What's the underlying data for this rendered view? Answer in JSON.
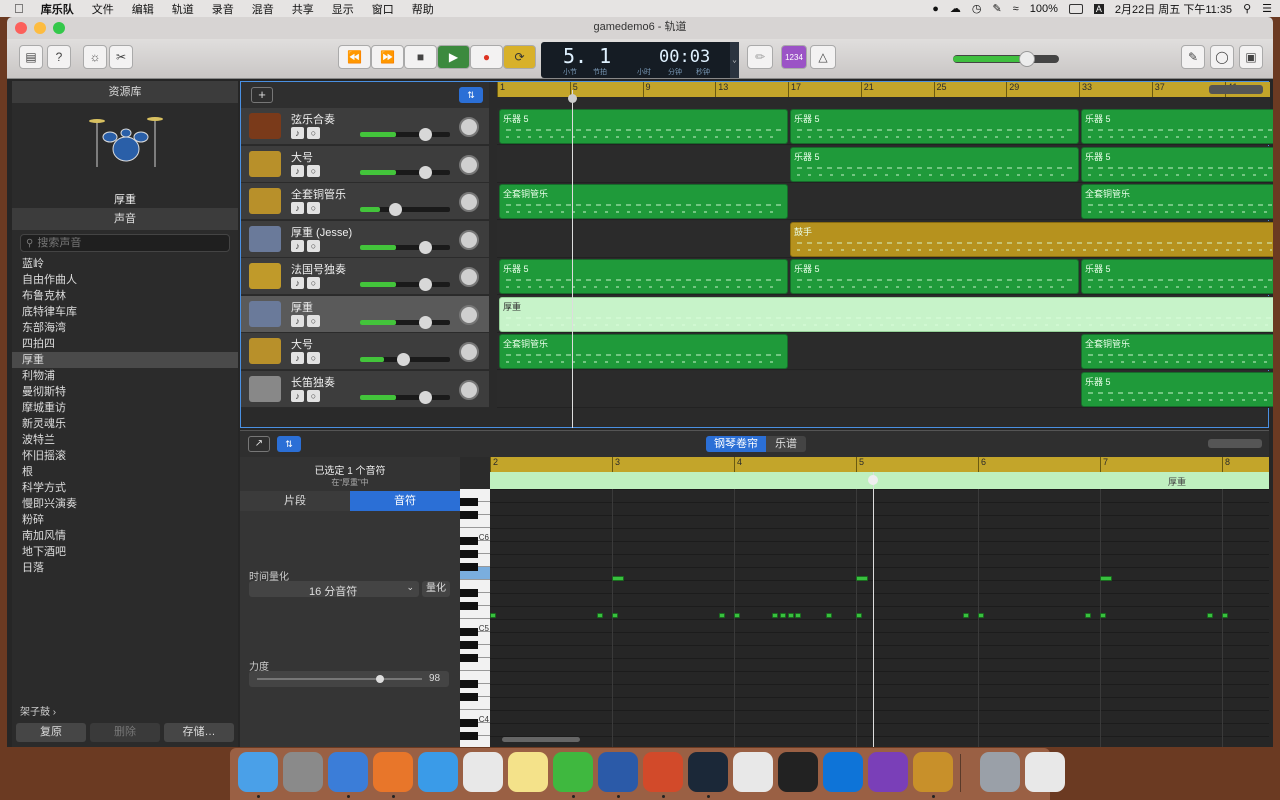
{
  "menubar": {
    "app": "库乐队",
    "items": [
      "文件",
      "编辑",
      "轨道",
      "录音",
      "混音",
      "共享",
      "显示",
      "窗口",
      "帮助"
    ],
    "battery": "100%",
    "clock": "2月22日 周五 下午11:35"
  },
  "window": {
    "title": "gamedemo6 - 轨道"
  },
  "lcd": {
    "bar_beat": "5. 1",
    "bar_label": "小节",
    "beat_label": "节拍",
    "time": "00:03",
    "hour_label": "小时",
    "min_label": "分钟",
    "sec_label": "秒钟"
  },
  "toolbar": {
    "count_in": "1234"
  },
  "library": {
    "header": "资源库",
    "patch_name": "厚重",
    "sounds_header": "声音",
    "search_placeholder": "搜索声音",
    "sounds": [
      "蓝岭",
      "自由作曲人",
      "布鲁克林",
      "底特律车库",
      "东部海湾",
      "四拍四",
      "厚重",
      "利物浦",
      "曼彻斯特",
      "摩城重访",
      "新灵魂乐",
      "波特兰",
      "怀旧摇滚",
      "根",
      "科学方式",
      "慢即兴演奏",
      "粉碎",
      "南加风情",
      "地下酒吧",
      "日落"
    ],
    "selected_index": 6,
    "kit_label": "架子鼓",
    "revert": "复原",
    "delete": "删除",
    "save": "存储…"
  },
  "ruler": {
    "bars": [
      "1",
      "5",
      "9",
      "13",
      "17",
      "21",
      "25",
      "29",
      "33",
      "37",
      "41"
    ]
  },
  "tracks": [
    {
      "name": "弦乐合奏",
      "color": "#7a3a1a",
      "vol": 0.73
    },
    {
      "name": "大号",
      "color": "#b8902a",
      "vol": 0.73
    },
    {
      "name": "全套铜管乐",
      "color": "#b8902a",
      "vol": 0.4
    },
    {
      "name": "厚重 (Jesse)",
      "color": "#6a7a9a",
      "vol": 0.73
    },
    {
      "name": "法国号独奏",
      "color": "#c09a2a",
      "vol": 0.73
    },
    {
      "name": "厚重",
      "color": "#6a7a9a",
      "vol": 0.73
    },
    {
      "name": "大号",
      "color": "#b8902a",
      "vol": 0.49
    },
    {
      "name": "长笛独奏",
      "color": "#888888",
      "vol": 0.73
    }
  ],
  "regions": [
    {
      "track": 0,
      "bar": 1,
      "len": 16,
      "label": "乐器 5",
      "kind": "green"
    },
    {
      "track": 0,
      "bar": 17,
      "len": 16,
      "label": "乐器 5",
      "kind": "green"
    },
    {
      "track": 0,
      "bar": 33,
      "len": 11,
      "label": "乐器 5",
      "kind": "green"
    },
    {
      "track": 1,
      "bar": 17,
      "len": 16,
      "label": "乐器 5",
      "kind": "green"
    },
    {
      "track": 1,
      "bar": 33,
      "len": 11,
      "label": "乐器 5",
      "kind": "green"
    },
    {
      "track": 2,
      "bar": 1,
      "len": 16,
      "label": "全套铜管乐",
      "kind": "green"
    },
    {
      "track": 2,
      "bar": 33,
      "len": 11,
      "label": "全套铜管乐",
      "kind": "green"
    },
    {
      "track": 3,
      "bar": 17,
      "len": 27,
      "label": "鼓手",
      "kind": "drum"
    },
    {
      "track": 4,
      "bar": 1,
      "len": 16,
      "label": "乐器 5",
      "kind": "green"
    },
    {
      "track": 4,
      "bar": 17,
      "len": 16,
      "label": "乐器 5",
      "kind": "green"
    },
    {
      "track": 4,
      "bar": 33,
      "len": 11,
      "label": "乐器 5",
      "kind": "green"
    },
    {
      "track": 5,
      "bar": 1,
      "len": 43,
      "label": "厚重",
      "kind": "selected"
    },
    {
      "track": 6,
      "bar": 1,
      "len": 16,
      "label": "全套铜管乐",
      "kind": "green"
    },
    {
      "track": 6,
      "bar": 33,
      "len": 11,
      "label": "全套铜管乐",
      "kind": "green"
    },
    {
      "track": 7,
      "bar": 33,
      "len": 11,
      "label": "乐器 5",
      "kind": "green"
    }
  ],
  "editor": {
    "tab_piano": "钢琴卷帘",
    "tab_score": "乐谱",
    "selected_info": "已选定 1 个音符",
    "selected_sub": "在“厚重”中",
    "tab_region": "片段",
    "tab_notes": "音符",
    "quantize_label": "时间量化",
    "quantize_value": "16 分音符",
    "quantize_btn": "量化",
    "velocity_label": "力度",
    "velocity_value": "98",
    "region_name": "厚重",
    "bars": [
      "2",
      "3",
      "4",
      "5",
      "6",
      "7",
      "8"
    ],
    "keys": [
      "C6",
      "C5",
      "C4"
    ]
  },
  "dock": {
    "icons": [
      "Finder",
      "Launchpad",
      "QQ浏览器",
      "Firefox",
      "Safari",
      "Chrome",
      "便笺",
      "微信",
      "Word",
      "PowerPoint",
      "Steam",
      "Parallels",
      "Unity",
      "TeamViewer",
      "Visual Studio",
      "GarageBand",
      "Preview",
      "废纸篓"
    ]
  }
}
